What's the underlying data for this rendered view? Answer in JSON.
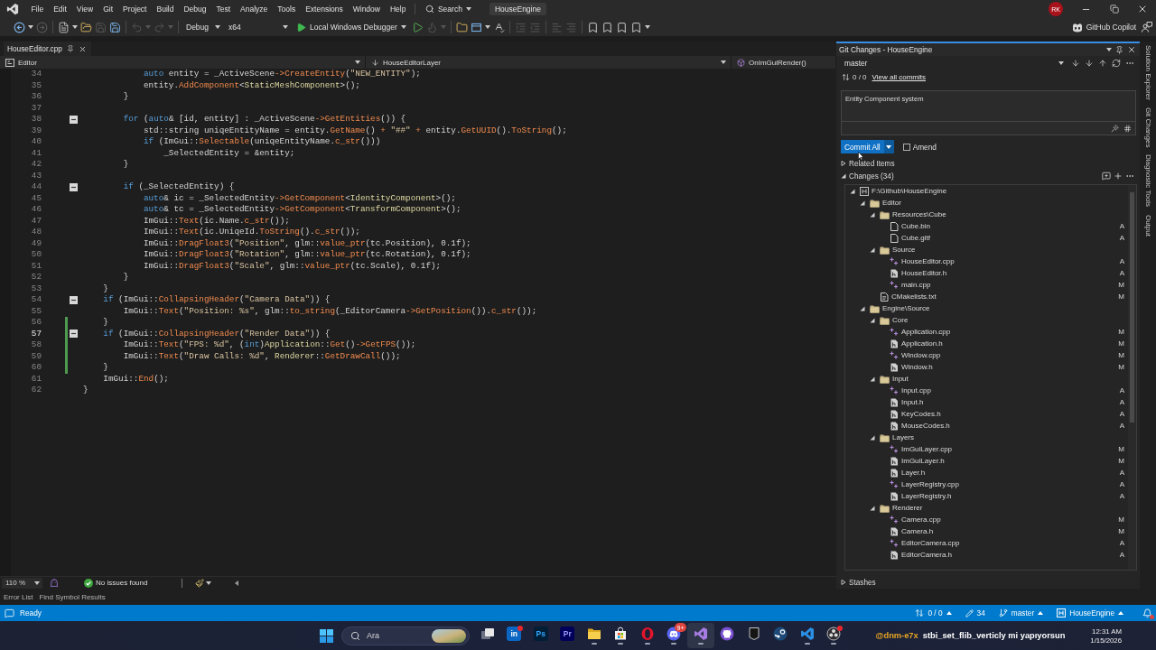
{
  "title_bar": {
    "menus": [
      "File",
      "Edit",
      "View",
      "Git",
      "Project",
      "Build",
      "Debug",
      "Test",
      "Analyze",
      "Tools",
      "Extensions",
      "Window",
      "Help"
    ],
    "search": "Search",
    "solution": "HouseEngine",
    "avatar": "RK"
  },
  "toolbar": {
    "groups": [
      [
        {
          "kind": "back",
          "disabled": false
        },
        {
          "kind": "forward",
          "disabled": true
        }
      ],
      [
        {
          "kind": "new_item",
          "disabled": false
        },
        {
          "kind": "open",
          "disabled": false
        },
        {
          "kind": "save",
          "disabled": true
        },
        {
          "kind": "save_all",
          "disabled": false
        }
      ],
      [
        {
          "kind": "undo",
          "disabled": true
        },
        {
          "kind": "redo",
          "disabled": true
        }
      ],
      [
        {
          "kind": "configuration",
          "label": "Debug"
        },
        {
          "kind": "platform",
          "label": "x64"
        },
        {
          "kind": "run",
          "label": "Local Windows Debugger"
        },
        {
          "kind": "start",
          "disabled": false
        },
        {
          "kind": "hot_reload",
          "disabled": true
        }
      ],
      [
        {
          "kind": "browse",
          "disabled": false
        },
        {
          "kind": "window",
          "disabled": false
        },
        {
          "kind": "spell",
          "disabled": false
        }
      ],
      [
        {
          "kind": "indent",
          "disabled": true
        },
        {
          "kind": "outdent",
          "disabled": true
        }
      ],
      [
        {
          "kind": "comment",
          "disabled": true
        },
        {
          "kind": "uncomment",
          "disabled": true
        }
      ],
      [
        {
          "kind": "bookmark",
          "disabled": false
        },
        {
          "kind": "bookmark_prev",
          "disabled": false
        },
        {
          "kind": "bookmark_next",
          "disabled": false
        },
        {
          "kind": "bookmark_clear",
          "disabled": false
        }
      ]
    ],
    "copilot": "GitHub Copilot"
  },
  "editor": {
    "tabs": [
      {
        "title": "HouseEditor.cpp",
        "selected": true
      }
    ],
    "nav": {
      "project": "Editor",
      "scope": "HouseEditorLayer",
      "member": "OnImGuiRender()"
    },
    "lines": [
      {
        "children": [
          {
            "children": [
              {
                "children": [
                  {
                    "number": "34",
                    "tokens": [
                      {
                        "kind": "keyword",
                        "text": "auto"
                      },
                      {
                        "kind": "plain",
                        "text": " entity = _ActiveScene"
                      },
                      {
                        "kind": "operator",
                        "text": "->"
                      },
                      {
                        "kind": "function",
                        "text": "CreateEntity"
                      },
                      {
                        "kind": "plain",
                        "text": "("
                      },
                      {
                        "kind": "string",
                        "text": "\"NEW_ENTITY\""
                      },
                      {
                        "kind": "plain",
                        "text": ");"
                      }
                    ],
                    "current": false,
                    "changed": false,
                    "foldable": false
                  },
                  {
                    "number": "35",
                    "tokens": [
                      {
                        "kind": "plain",
                        "text": "entity."
                      },
                      {
                        "kind": "function",
                        "text": "AddComponent"
                      },
                      {
                        "kind": "plain",
                        "text": "<"
                      },
                      {
                        "kind": "type",
                        "text": "StaticMeshComponent"
                      },
                      {
                        "kind": "plain",
                        "text": ">();"
                      }
                    ],
                    "current": false,
                    "changed": false,
                    "foldable": false
                  }
                ]
              },
              {
                "number": "36",
                "tokens": [
                  {
                    "kind": "plain",
                    "text": "}"
                  }
                ],
                "current": false,
                "changed": false,
                "foldable": false
              },
              {
                "number": "37",
                "current": false,
                "changed": false,
                "foldable": false
              },
              {
                "number": "38",
                "tokens": [
                  {
                    "kind": "keyword",
                    "text": "for"
                  },
                  {
                    "kind": "plain",
                    "text": " ("
                  },
                  {
                    "kind": "keyword",
                    "text": "auto"
                  },
                  {
                    "kind": "plain",
                    "text": "& [id, entity] : _ActiveScene"
                  },
                  {
                    "kind": "operator",
                    "text": "->"
                  },
                  {
                    "kind": "function",
                    "text": "GetEntities"
                  },
                  {
                    "kind": "plain",
                    "text": "()) {"
                  }
                ],
                "current": false,
                "changed": false,
                "foldable": true,
                "children": [
                  {
                    "number": "39",
                    "tokens": [
                      {
                        "kind": "plain",
                        "text": "std::string uniqeEntityName = entity."
                      },
                      {
                        "kind": "function",
                        "text": "GetName"
                      },
                      {
                        "kind": "plain",
                        "text": "() "
                      },
                      {
                        "kind": "operator",
                        "text": "+"
                      },
                      {
                        "kind": "string",
                        "text": " \"##\" "
                      },
                      {
                        "kind": "operator",
                        "text": "+"
                      },
                      {
                        "kind": "plain",
                        "text": " entity."
                      },
                      {
                        "kind": "function",
                        "text": "GetUUID"
                      },
                      {
                        "kind": "plain",
                        "text": "()."
                      },
                      {
                        "kind": "function",
                        "text": "ToString"
                      },
                      {
                        "kind": "plain",
                        "text": "();"
                      }
                    ],
                    "current": false,
                    "changed": false,
                    "foldable": false
                  },
                  {
                    "number": "40",
                    "tokens": [
                      {
                        "kind": "keyword",
                        "text": "if"
                      },
                      {
                        "kind": "plain",
                        "text": " (ImGui::"
                      },
                      {
                        "kind": "function",
                        "text": "Selectable"
                      },
                      {
                        "kind": "plain",
                        "text": "(uniqeEntityName."
                      },
                      {
                        "kind": "function",
                        "text": "c_str"
                      },
                      {
                        "kind": "plain",
                        "text": "()))"
                      }
                    ],
                    "current": false,
                    "changed": false,
                    "foldable": false,
                    "children": [
                      {
                        "number": "41",
                        "tokens": [
                          {
                            "kind": "plain",
                            "text": "_SelectedEntity = &entity;"
                          }
                        ],
                        "current": false,
                        "changed": false,
                        "foldable": false
                      }
                    ]
                  }
                ]
              },
              {
                "number": "42",
                "tokens": [
                  {
                    "kind": "plain",
                    "text": "}"
                  }
                ],
                "current": false,
                "changed": false,
                "foldable": false
              },
              {
                "number": "43",
                "current": false,
                "changed": false,
                "foldable": false
              },
              {
                "number": "44",
                "tokens": [
                  {
                    "kind": "keyword",
                    "text": "if"
                  },
                  {
                    "kind": "plain",
                    "text": " (_SelectedEntity) {"
                  }
                ],
                "current": false,
                "changed": false,
                "foldable": true,
                "children": [
                  {
                    "number": "45",
                    "tokens": [
                      {
                        "kind": "keyword",
                        "text": "auto"
                      },
                      {
                        "kind": "plain",
                        "text": "& ic = _SelectedEntity"
                      },
                      {
                        "kind": "operator",
                        "text": "->"
                      },
                      {
                        "kind": "function",
                        "text": "GetComponent"
                      },
                      {
                        "kind": "plain",
                        "text": "<"
                      },
                      {
                        "kind": "type",
                        "text": "IdentityComponent"
                      },
                      {
                        "kind": "plain",
                        "text": ">();"
                      }
                    ],
                    "current": false,
                    "changed": false,
                    "foldable": false
                  },
                  {
                    "number": "46",
                    "tokens": [
                      {
                        "kind": "keyword",
                        "text": "auto"
                      },
                      {
                        "kind": "plain",
                        "text": "& tc = _SelectedEntity"
                      },
                      {
                        "kind": "operator",
                        "text": "->"
                      },
                      {
                        "kind": "function",
                        "text": "GetComponent"
                      },
                      {
                        "kind": "plain",
                        "text": "<"
                      },
                      {
                        "kind": "type",
                        "text": "TransformComponent"
                      },
                      {
                        "kind": "plain",
                        "text": ">();"
                      }
                    ],
                    "current": false,
                    "changed": false,
                    "foldable": false
                  },
                  {
                    "number": "47",
                    "tokens": [
                      {
                        "kind": "plain",
                        "text": "ImGui::"
                      },
                      {
                        "kind": "function",
                        "text": "Text"
                      },
                      {
                        "kind": "plain",
                        "text": "(ic.Name."
                      },
                      {
                        "kind": "function",
                        "text": "c_str"
                      },
                      {
                        "kind": "plain",
                        "text": "());"
                      }
                    ],
                    "current": false,
                    "changed": false,
                    "foldable": false
                  },
                  {
                    "number": "48",
                    "tokens": [
                      {
                        "kind": "plain",
                        "text": "ImGui::"
                      },
                      {
                        "kind": "function",
                        "text": "Text"
                      },
                      {
                        "kind": "plain",
                        "text": "(ic.UniqeId."
                      },
                      {
                        "kind": "function",
                        "text": "ToString"
                      },
                      {
                        "kind": "plain",
                        "text": "()."
                      },
                      {
                        "kind": "function",
                        "text": "c_str"
                      },
                      {
                        "kind": "plain",
                        "text": "());"
                      }
                    ],
                    "current": false,
                    "changed": false,
                    "foldable": false
                  },
                  {
                    "number": "49",
                    "tokens": [
                      {
                        "kind": "plain",
                        "text": "ImGui::"
                      },
                      {
                        "kind": "function",
                        "text": "DragFloat3"
                      },
                      {
                        "kind": "plain",
                        "text": "("
                      },
                      {
                        "kind": "string",
                        "text": "\"Position\""
                      },
                      {
                        "kind": "plain",
                        "text": ", glm::"
                      },
                      {
                        "kind": "function",
                        "text": "value_ptr"
                      },
                      {
                        "kind": "plain",
                        "text": "(tc.Position), 0.1f);"
                      }
                    ],
                    "current": false,
                    "changed": false,
                    "foldable": false
                  },
                  {
                    "number": "50",
                    "tokens": [
                      {
                        "kind": "plain",
                        "text": "ImGui::"
                      },
                      {
                        "kind": "function",
                        "text": "DragFloat3"
                      },
                      {
                        "kind": "plain",
                        "text": "("
                      },
                      {
                        "kind": "string",
                        "text": "\"Rotation\""
                      },
                      {
                        "kind": "plain",
                        "text": ", glm::"
                      },
                      {
                        "kind": "function",
                        "text": "value_ptr"
                      },
                      {
                        "kind": "plain",
                        "text": "(tc.Rotation), 0.1f);"
                      }
                    ],
                    "current": false,
                    "changed": false,
                    "foldable": false
                  },
                  {
                    "number": "51",
                    "tokens": [
                      {
                        "kind": "plain",
                        "text": "ImGui::"
                      },
                      {
                        "kind": "function",
                        "text": "DragFloat3"
                      },
                      {
                        "kind": "plain",
                        "text": "("
                      },
                      {
                        "kind": "string",
                        "text": "\"Scale\""
                      },
                      {
                        "kind": "plain",
                        "text": ", glm::"
                      },
                      {
                        "kind": "function",
                        "text": "value_ptr"
                      },
                      {
                        "kind": "plain",
                        "text": "(tc.Scale), 0.1f);"
                      }
                    ],
                    "current": false,
                    "changed": false,
                    "foldable": false
                  }
                ]
              },
              {
                "number": "52",
                "tokens": [
                  {
                    "kind": "plain",
                    "text": "}"
                  }
                ],
                "current": false,
                "changed": false,
                "foldable": false
              }
            ]
          },
          {
            "number": "53",
            "tokens": [
              {
                "kind": "plain",
                "text": "}"
              }
            ],
            "current": false,
            "changed": false,
            "foldable": false
          },
          {
            "number": "54",
            "tokens": [
              {
                "kind": "keyword",
                "text": "if"
              },
              {
                "kind": "plain",
                "text": " (ImGui::"
              },
              {
                "kind": "function",
                "text": "CollapsingHeader"
              },
              {
                "kind": "plain",
                "text": "("
              },
              {
                "kind": "string",
                "text": "\"Camera Data\""
              },
              {
                "kind": "plain",
                "text": ")) {"
              }
            ],
            "current": false,
            "changed": false,
            "foldable": true,
            "children": [
              {
                "number": "55",
                "tokens": [
                  {
                    "kind": "plain",
                    "text": "ImGui::"
                  },
                  {
                    "kind": "function",
                    "text": "Text"
                  },
                  {
                    "kind": "plain",
                    "text": "("
                  },
                  {
                    "kind": "string",
                    "text": "\"Position: %s\""
                  },
                  {
                    "kind": "plain",
                    "text": ", glm::"
                  },
                  {
                    "kind": "function",
                    "text": "to_string"
                  },
                  {
                    "kind": "plain",
                    "text": "(_EditorCamera"
                  },
                  {
                    "kind": "operator",
                    "text": "->"
                  },
                  {
                    "kind": "function",
                    "text": "GetPosition"
                  },
                  {
                    "kind": "plain",
                    "text": "())."
                  },
                  {
                    "kind": "function",
                    "text": "c_str"
                  },
                  {
                    "kind": "plain",
                    "text": "());"
                  }
                ],
                "current": false,
                "changed": false,
                "foldable": false
              }
            ]
          },
          {
            "number": "56",
            "tokens": [
              {
                "kind": "plain",
                "text": "}"
              }
            ],
            "current": false,
            "changed": true,
            "foldable": false
          },
          {
            "number": "57",
            "tokens": [
              {
                "kind": "keyword",
                "text": "if"
              },
              {
                "kind": "plain",
                "text": " (ImGui::"
              },
              {
                "kind": "function",
                "text": "CollapsingHeader"
              },
              {
                "kind": "plain",
                "text": "("
              },
              {
                "kind": "string",
                "text": "\"Render Data\""
              },
              {
                "kind": "plain",
                "text": ")) {"
              }
            ],
            "current": true,
            "changed": true,
            "foldable": true,
            "children": [
              {
                "number": "58",
                "tokens": [
                  {
                    "kind": "plain",
                    "text": "ImGui::"
                  },
                  {
                    "kind": "function",
                    "text": "Text"
                  },
                  {
                    "kind": "plain",
                    "text": "("
                  },
                  {
                    "kind": "string",
                    "text": "\"FPS: %d\""
                  },
                  {
                    "kind": "plain",
                    "text": ", ("
                  },
                  {
                    "kind": "keyword",
                    "text": "int"
                  },
                  {
                    "kind": "plain",
                    "text": ")"
                  },
                  {
                    "kind": "type",
                    "text": "Application"
                  },
                  {
                    "kind": "plain",
                    "text": "::"
                  },
                  {
                    "kind": "function",
                    "text": "Get"
                  },
                  {
                    "kind": "plain",
                    "text": "()"
                  },
                  {
                    "kind": "operator",
                    "text": "->"
                  },
                  {
                    "kind": "function",
                    "text": "GetFPS"
                  },
                  {
                    "kind": "plain",
                    "text": "());"
                  }
                ],
                "current": false,
                "changed": true,
                "foldable": false
              },
              {
                "number": "59",
                "tokens": [
                  {
                    "kind": "plain",
                    "text": "ImGui::"
                  },
                  {
                    "kind": "function",
                    "text": "Text"
                  },
                  {
                    "kind": "plain",
                    "text": "("
                  },
                  {
                    "kind": "string",
                    "text": "\"Draw Calls: %d\""
                  },
                  {
                    "kind": "plain",
                    "text": ", "
                  },
                  {
                    "kind": "type",
                    "text": "Renderer"
                  },
                  {
                    "kind": "plain",
                    "text": "::"
                  },
                  {
                    "kind": "function",
                    "text": "GetDrawCall"
                  },
                  {
                    "kind": "plain",
                    "text": "());"
                  }
                ],
                "current": false,
                "changed": true,
                "foldable": false
              }
            ]
          },
          {
            "number": "60",
            "tokens": [
              {
                "kind": "plain",
                "text": "}"
              }
            ],
            "current": false,
            "changed": true,
            "foldable": false
          },
          {
            "number": "61",
            "tokens": [
              {
                "kind": "plain",
                "text": "ImGui::"
              },
              {
                "kind": "function",
                "text": "End"
              },
              {
                "kind": "plain",
                "text": "();"
              }
            ],
            "current": false,
            "changed": false,
            "foldable": false
          }
        ]
      },
      {
        "number": "62",
        "tokens": [
          {
            "kind": "plain",
            "text": "}"
          }
        ],
        "current": false,
        "changed": false,
        "foldable": false
      }
    ],
    "zoom": "110 %",
    "issues": "No issues found"
  },
  "git_changes": {
    "title": "Git Changes - HouseEngine",
    "branch": "master",
    "outgoing": "0 / 0",
    "history_link": "View all commits",
    "message": "Entity Component system",
    "commit_button": "Commit All",
    "amend": {
      "label": "Amend",
      "checked": false
    },
    "sections": [
      {
        "label": "Related Items",
        "expanded": false
      },
      {
        "label": "Changes (34)",
        "expanded": true,
        "tree": [
          {
            "name": "F:\\Github\\HouseEngine",
            "kind": "repo",
            "expanded": true,
            "children": [
              {
                "name": "Editor",
                "kind": "folder",
                "expanded": true,
                "children": [
                  {
                    "name": "Resources\\Cube",
                    "kind": "folder",
                    "expanded": true,
                    "children": [
                      {
                        "name": "Cube.bin",
                        "kind": "file",
                        "status": "A"
                      },
                      {
                        "name": "Cube.gltf",
                        "kind": "file",
                        "status": "A"
                      }
                    ]
                  },
                  {
                    "name": "Source",
                    "kind": "folder",
                    "expanded": true,
                    "children": [
                      {
                        "name": "HouseEditor.cpp",
                        "kind": "cpp",
                        "status": "A"
                      },
                      {
                        "name": "HouseEditor.h",
                        "kind": "header",
                        "status": "A"
                      },
                      {
                        "name": "main.cpp",
                        "kind": "cpp",
                        "status": "M"
                      }
                    ]
                  },
                  {
                    "name": "CMakelists.txt",
                    "kind": "text",
                    "status": "M"
                  }
                ]
              },
              {
                "name": "Engine\\Source",
                "kind": "folder",
                "expanded": true,
                "children": [
                  {
                    "name": "Core",
                    "kind": "folder",
                    "expanded": true,
                    "children": [
                      {
                        "name": "Application.cpp",
                        "kind": "cpp",
                        "status": "M"
                      },
                      {
                        "name": "Application.h",
                        "kind": "header",
                        "status": "M"
                      },
                      {
                        "name": "Window.cpp",
                        "kind": "cpp",
                        "status": "M"
                      },
                      {
                        "name": "Window.h",
                        "kind": "header",
                        "status": "M"
                      }
                    ]
                  },
                  {
                    "name": "Input",
                    "kind": "folder",
                    "expanded": true,
                    "children": [
                      {
                        "name": "Input.cpp",
                        "kind": "cpp",
                        "status": "A"
                      },
                      {
                        "name": "Input.h",
                        "kind": "header",
                        "status": "A"
                      },
                      {
                        "name": "KeyCodes.h",
                        "kind": "header",
                        "status": "A"
                      },
                      {
                        "name": "MouseCodes.h",
                        "kind": "header",
                        "status": "A"
                      }
                    ]
                  },
                  {
                    "name": "Layers",
                    "kind": "folder",
                    "expanded": true,
                    "children": [
                      {
                        "name": "ImGuiLayer.cpp",
                        "kind": "cpp",
                        "status": "M"
                      },
                      {
                        "name": "ImGuiLayer.h",
                        "kind": "header",
                        "status": "M"
                      },
                      {
                        "name": "Layer.h",
                        "kind": "header",
                        "status": "A"
                      },
                      {
                        "name": "LayerRegistry.cpp",
                        "kind": "cpp",
                        "status": "A"
                      },
                      {
                        "name": "LayerRegistry.h",
                        "kind": "header",
                        "status": "A"
                      }
                    ]
                  },
                  {
                    "name": "Renderer",
                    "kind": "folder",
                    "expanded": true,
                    "children": [
                      {
                        "name": "Camera.cpp",
                        "kind": "cpp",
                        "status": "M"
                      },
                      {
                        "name": "Camera.h",
                        "kind": "header",
                        "status": "M"
                      },
                      {
                        "name": "EditorCamera.cpp",
                        "kind": "cpp",
                        "status": "A"
                      },
                      {
                        "name": "EditorCamera.h",
                        "kind": "header",
                        "status": "A"
                      }
                    ]
                  }
                ]
              }
            ]
          }
        ]
      },
      {
        "label": "Stashes",
        "expanded": false
      }
    ]
  },
  "side_tabs": [
    "Solution Explorer",
    "Git Changes",
    "Diagnostic Tools",
    "Output"
  ],
  "bottom_tabs": [
    "Error List",
    "Find Symbol Results"
  ],
  "status_bar": {
    "message": "Ready",
    "sync": "0 / 0",
    "edits": "34",
    "branch": "master",
    "repo": "HouseEngine",
    "notified": true
  },
  "taskbar": {
    "search": {
      "placeholder": "Ara"
    },
    "apps": [
      {
        "kind": "taskview",
        "running": false,
        "selected": false,
        "notified": false
      },
      {
        "kind": "linkedin",
        "label": "in",
        "running": false,
        "selected": false,
        "notified": true
      },
      {
        "kind": "photoshop",
        "label": "Ps",
        "running": false,
        "selected": false,
        "notified": false
      },
      {
        "kind": "premiere",
        "label": "Pr",
        "running": false,
        "selected": false,
        "notified": false
      },
      {
        "kind": "explorer",
        "running": true,
        "selected": false,
        "notified": false
      },
      {
        "kind": "store",
        "running": true,
        "selected": false,
        "notified": false
      },
      {
        "kind": "opera",
        "running": true,
        "selected": false,
        "notified": false
      },
      {
        "kind": "discord",
        "badge": "9+",
        "running": true,
        "selected": false,
        "notified": false
      },
      {
        "kind": "studio",
        "running": true,
        "selected": true,
        "notified": false
      },
      {
        "kind": "github",
        "running": false,
        "selected": false,
        "notified": false
      },
      {
        "kind": "epic",
        "running": false,
        "selected": false,
        "notified": false
      },
      {
        "kind": "steam",
        "running": false,
        "selected": false,
        "notified": false
      },
      {
        "kind": "vscode",
        "running": true,
        "selected": false,
        "notified": false
      },
      {
        "kind": "obs",
        "running": true,
        "selected": false,
        "notified": true
      }
    ],
    "overlay": {
      "user": "@dnm-e7x",
      "message": "stbi_set_flib_verticly mi yapıyorsun"
    },
    "time": "12:31 AM",
    "date": "1/15/2026"
  }
}
